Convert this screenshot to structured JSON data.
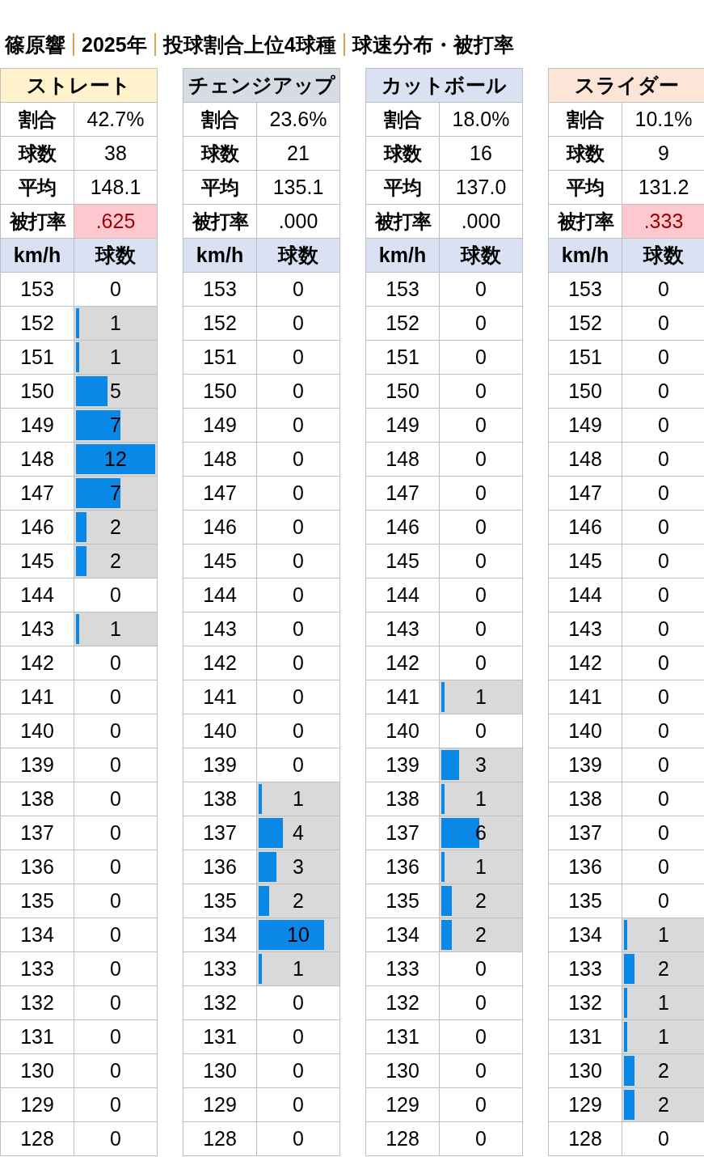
{
  "title_parts": [
    "篠原響",
    "2025年",
    "投球割合上位4球種",
    "球速分布・被打率"
  ],
  "pitches": [
    {
      "name": "ストレート",
      "color": "#fff2cc",
      "stats": [
        {
          "label": "割合",
          "value": "42.7%",
          "highlight": false
        },
        {
          "label": "球数",
          "value": "38",
          "highlight": false
        },
        {
          "label": "平均",
          "value": "148.1",
          "highlight": false
        },
        {
          "label": "被打率",
          "value": ".625",
          "highlight": true
        }
      ],
      "columns": [
        "km/h",
        "球数"
      ],
      "rows": [
        {
          "speed": "153",
          "count": "0"
        },
        {
          "speed": "152",
          "count": "1",
          "level": 0.083
        },
        {
          "speed": "151",
          "count": "1",
          "level": 0.083
        },
        {
          "speed": "150",
          "count": "5",
          "level": 0.417
        },
        {
          "speed": "149",
          "count": "7",
          "level": 0.583
        },
        {
          "speed": "148",
          "count": "12",
          "level": 1
        },
        {
          "speed": "147",
          "count": "7",
          "level": 0.583
        },
        {
          "speed": "146",
          "count": "2",
          "level": 0.167
        },
        {
          "speed": "145",
          "count": "2",
          "level": 0.167
        },
        {
          "speed": "144",
          "count": "0"
        },
        {
          "speed": "143",
          "count": "1",
          "level": 0.083
        },
        {
          "speed": "142",
          "count": "0"
        },
        {
          "speed": "141",
          "count": "0"
        },
        {
          "speed": "140",
          "count": "0"
        },
        {
          "speed": "139",
          "count": "0"
        },
        {
          "speed": "138",
          "count": "0"
        },
        {
          "speed": "137",
          "count": "0"
        },
        {
          "speed": "136",
          "count": "0"
        },
        {
          "speed": "135",
          "count": "0"
        },
        {
          "speed": "134",
          "count": "0"
        },
        {
          "speed": "133",
          "count": "0"
        },
        {
          "speed": "132",
          "count": "0"
        },
        {
          "speed": "131",
          "count": "0"
        },
        {
          "speed": "130",
          "count": "0"
        },
        {
          "speed": "129",
          "count": "0"
        },
        {
          "speed": "128",
          "count": "0"
        }
      ]
    },
    {
      "name": "チェンジアップ",
      "color": "#d6dce4",
      "stats": [
        {
          "label": "割合",
          "value": "23.6%",
          "highlight": false
        },
        {
          "label": "球数",
          "value": "21",
          "highlight": false
        },
        {
          "label": "平均",
          "value": "135.1",
          "highlight": false
        },
        {
          "label": "被打率",
          "value": ".000",
          "highlight": false
        }
      ],
      "columns": [
        "km/h",
        "球数"
      ],
      "rows": [
        {
          "speed": "153",
          "count": "0"
        },
        {
          "speed": "152",
          "count": "0"
        },
        {
          "speed": "151",
          "count": "0"
        },
        {
          "speed": "150",
          "count": "0"
        },
        {
          "speed": "149",
          "count": "0"
        },
        {
          "speed": "148",
          "count": "0"
        },
        {
          "speed": "147",
          "count": "0"
        },
        {
          "speed": "146",
          "count": "0"
        },
        {
          "speed": "145",
          "count": "0"
        },
        {
          "speed": "144",
          "count": "0"
        },
        {
          "speed": "143",
          "count": "0"
        },
        {
          "speed": "142",
          "count": "0"
        },
        {
          "speed": "141",
          "count": "0"
        },
        {
          "speed": "140",
          "count": "0"
        },
        {
          "speed": "139",
          "count": "0"
        },
        {
          "speed": "138",
          "count": "1",
          "level": 0.083
        },
        {
          "speed": "137",
          "count": "4",
          "level": 0.333
        },
        {
          "speed": "136",
          "count": "3",
          "level": 0.25
        },
        {
          "speed": "135",
          "count": "2",
          "level": 0.167
        },
        {
          "speed": "134",
          "count": "10",
          "level": 0.833
        },
        {
          "speed": "133",
          "count": "1",
          "level": 0.083
        },
        {
          "speed": "132",
          "count": "0"
        },
        {
          "speed": "131",
          "count": "0"
        },
        {
          "speed": "130",
          "count": "0"
        },
        {
          "speed": "129",
          "count": "0"
        },
        {
          "speed": "128",
          "count": "0"
        }
      ]
    },
    {
      "name": "カットボール",
      "color": "#d9e1f2",
      "stats": [
        {
          "label": "割合",
          "value": "18.0%",
          "highlight": false
        },
        {
          "label": "球数",
          "value": "16",
          "highlight": false
        },
        {
          "label": "平均",
          "value": "137.0",
          "highlight": false
        },
        {
          "label": "被打率",
          "value": ".000",
          "highlight": false
        }
      ],
      "columns": [
        "km/h",
        "球数"
      ],
      "rows": [
        {
          "speed": "153",
          "count": "0"
        },
        {
          "speed": "152",
          "count": "0"
        },
        {
          "speed": "151",
          "count": "0"
        },
        {
          "speed": "150",
          "count": "0"
        },
        {
          "speed": "149",
          "count": "0"
        },
        {
          "speed": "148",
          "count": "0"
        },
        {
          "speed": "147",
          "count": "0"
        },
        {
          "speed": "146",
          "count": "0"
        },
        {
          "speed": "145",
          "count": "0"
        },
        {
          "speed": "144",
          "count": "0"
        },
        {
          "speed": "143",
          "count": "0"
        },
        {
          "speed": "142",
          "count": "0"
        },
        {
          "speed": "141",
          "count": "1",
          "level": 0.083
        },
        {
          "speed": "140",
          "count": "0"
        },
        {
          "speed": "139",
          "count": "3",
          "level": 0.25
        },
        {
          "speed": "138",
          "count": "1",
          "level": 0.083
        },
        {
          "speed": "137",
          "count": "6",
          "level": 0.5
        },
        {
          "speed": "136",
          "count": "1",
          "level": 0.083
        },
        {
          "speed": "135",
          "count": "2",
          "level": 0.167
        },
        {
          "speed": "134",
          "count": "2",
          "level": 0.167
        },
        {
          "speed": "133",
          "count": "0"
        },
        {
          "speed": "132",
          "count": "0"
        },
        {
          "speed": "131",
          "count": "0"
        },
        {
          "speed": "130",
          "count": "0"
        },
        {
          "speed": "129",
          "count": "0"
        },
        {
          "speed": "128",
          "count": "0"
        }
      ]
    },
    {
      "name": "スライダー",
      "color": "#fce4d6",
      "stats": [
        {
          "label": "割合",
          "value": "10.1%",
          "highlight": false
        },
        {
          "label": "球数",
          "value": "9",
          "highlight": false
        },
        {
          "label": "平均",
          "value": "131.2",
          "highlight": false
        },
        {
          "label": "被打率",
          "value": ".333",
          "highlight": true
        }
      ],
      "columns": [
        "km/h",
        "球数"
      ],
      "rows": [
        {
          "speed": "153",
          "count": "0"
        },
        {
          "speed": "152",
          "count": "0"
        },
        {
          "speed": "151",
          "count": "0"
        },
        {
          "speed": "150",
          "count": "0"
        },
        {
          "speed": "149",
          "count": "0"
        },
        {
          "speed": "148",
          "count": "0"
        },
        {
          "speed": "147",
          "count": "0"
        },
        {
          "speed": "146",
          "count": "0"
        },
        {
          "speed": "145",
          "count": "0"
        },
        {
          "speed": "144",
          "count": "0"
        },
        {
          "speed": "143",
          "count": "0"
        },
        {
          "speed": "142",
          "count": "0"
        },
        {
          "speed": "141",
          "count": "0"
        },
        {
          "speed": "140",
          "count": "0"
        },
        {
          "speed": "139",
          "count": "0"
        },
        {
          "speed": "138",
          "count": "0"
        },
        {
          "speed": "137",
          "count": "0"
        },
        {
          "speed": "136",
          "count": "0"
        },
        {
          "speed": "135",
          "count": "0"
        },
        {
          "speed": "134",
          "count": "1",
          "level": 0.083
        },
        {
          "speed": "133",
          "count": "2",
          "level": 0.167
        },
        {
          "speed": "132",
          "count": "1",
          "level": 0.083
        },
        {
          "speed": "131",
          "count": "1",
          "level": 0.083
        },
        {
          "speed": "130",
          "count": "2",
          "level": 0.167
        },
        {
          "speed": "129",
          "count": "2",
          "level": 0.167
        },
        {
          "speed": "128",
          "count": "0"
        }
      ]
    }
  ]
}
